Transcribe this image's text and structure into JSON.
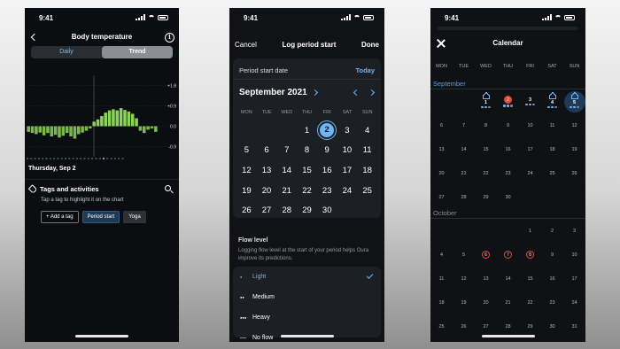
{
  "status_time": "9:41",
  "phone1": {
    "title": "Body temperature",
    "tabs": [
      "Daily",
      "Trend"
    ],
    "y_ticks": [
      "+1.8",
      "+0.9",
      "0.0",
      "-0.9"
    ],
    "date": "Thursday, Sep 2",
    "tags_title": "Tags and activities",
    "tags_sub": "Tap a tag to highlight it on the chart",
    "chips": [
      "+ Add a tag",
      "Period start",
      "Yoga"
    ],
    "chart_data": {
      "type": "bar",
      "y_ticks": [
        "+1.8",
        "+0.9",
        "0.0",
        "-0.9"
      ],
      "ylim": [
        -1.35,
        2.25
      ],
      "values": [
        -0.25,
        -0.3,
        -0.35,
        -0.28,
        -0.4,
        -0.3,
        -0.45,
        -0.38,
        -0.5,
        -0.42,
        -0.3,
        -0.45,
        -0.55,
        -0.35,
        -0.28,
        -0.2,
        -0.1,
        0.2,
        0.3,
        0.45,
        0.6,
        0.7,
        0.75,
        0.7,
        0.8,
        0.72,
        0.65,
        0.55,
        0.35,
        -0.2,
        -0.3,
        -0.15,
        -0.1,
        -0.25
      ]
    }
  },
  "phone2": {
    "cancel": "Cancel",
    "title": "Log period start",
    "done": "Done",
    "psd_label": "Period start date",
    "today": "Today",
    "month": "September 2021",
    "dow": [
      "MON",
      "TUE",
      "WED",
      "THU",
      "FRI",
      "SAT",
      "SUN"
    ],
    "days": [
      "",
      "",
      "",
      "1",
      "2",
      "3",
      "4",
      "5",
      "6",
      "7",
      "8",
      "9",
      "10",
      "11",
      "12",
      "13",
      "14",
      "15",
      "16",
      "17",
      "18",
      "19",
      "20",
      "21",
      "22",
      "23",
      "24",
      "25",
      "26",
      "27",
      "28",
      "29",
      "30",
      "",
      ""
    ],
    "selected_day": "2",
    "flow_title": "Flow level",
    "flow_desc": "Logging flow level at the start of your period helps Oura improve its predictions.",
    "flow_options": [
      {
        "label": "Light",
        "icon": "💧",
        "selected": true
      },
      {
        "label": "Medium",
        "icon": "💧💧",
        "selected": false
      },
      {
        "label": "Heavy",
        "icon": "💧💧💧",
        "selected": false
      },
      {
        "label": "No flow",
        "icon": "—",
        "selected": false
      }
    ]
  },
  "phone3": {
    "title": "Calendar",
    "dow": [
      "MON",
      "TUE",
      "WED",
      "THU",
      "FRI",
      "SAT",
      "SUN"
    ],
    "sep_label": "September",
    "oct_label": "October",
    "sep_days": [
      "",
      "",
      "1",
      "2",
      "3",
      "4",
      "5",
      "6",
      "7",
      "8",
      "9",
      "10",
      "11",
      "12",
      "13",
      "14",
      "15",
      "16",
      "17",
      "18",
      "19",
      "20",
      "21",
      "22",
      "23",
      "24",
      "25",
      "26",
      "27",
      "28",
      "29",
      "30",
      "",
      ""
    ],
    "oct_days": [
      "",
      "",
      "",
      "",
      "1",
      "2",
      "3",
      "4",
      "5",
      "6",
      "7",
      "8",
      "9",
      "10",
      "11",
      "12",
      "13",
      "14",
      "15",
      "16",
      "17",
      "18",
      "19",
      "20",
      "21",
      "22",
      "23",
      "24",
      "25",
      "26",
      "27",
      "28",
      "29",
      "30",
      "31"
    ],
    "accent": "#6fb6f2",
    "period_color": "#e34a3a"
  }
}
